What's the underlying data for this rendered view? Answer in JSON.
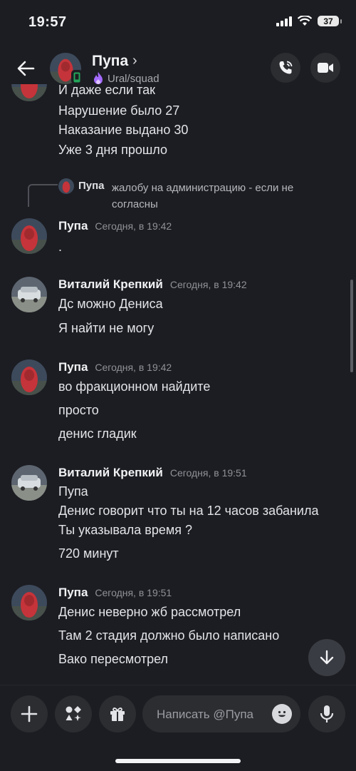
{
  "status_bar": {
    "time": "19:57",
    "battery": "37"
  },
  "header": {
    "name": "Пупа",
    "chevron": "›",
    "status": "Ural/squad",
    "icons": {
      "back": "arrow-left-icon",
      "call": "phone-call-icon",
      "video": "video-camera-icon"
    }
  },
  "messages": {
    "top_lines": [
      "И даже если так",
      "Нарушение было 27",
      "Наказание выдано 30",
      "Уже 3 дня прошло"
    ],
    "reply": {
      "author": "Пупа",
      "text": "жалобу на администрацию - если не согласны"
    },
    "groups": [
      {
        "author": "Пупа",
        "time": "Сегодня, в 19:42",
        "lines": [
          "."
        ]
      },
      {
        "author": "Виталий Крепкий",
        "time": "Сегодня, в 19:42",
        "lines": [
          "Дс можно Дениса",
          "Я найти не могу"
        ]
      },
      {
        "author": "Пупа",
        "time": "Сегодня, в 19:42",
        "lines": [
          "во фракционном найдите",
          "просто",
          "денис гладик"
        ]
      },
      {
        "author": "Виталий Крепкий",
        "time": "Сегодня, в 19:51",
        "lines": [
          "Пупа",
          "Денис говорит что ты на 12 часов забанила",
          "Ты указывала время ?",
          "720 минут"
        ]
      },
      {
        "author": "Пупа",
        "time": "Сегодня, в 19:51",
        "lines": [
          "Денис неверно жб рассмотрел",
          "Там 2 стадия должно было написано",
          "Вако пересмотрел"
        ]
      }
    ]
  },
  "composer": {
    "placeholder": "Написать @Пупа"
  },
  "colors": {
    "background": "#1c1d22",
    "surface": "#2b2d31",
    "text": "#f2f3f5",
    "muted": "#8f9198",
    "online_mobile": "#23a55a",
    "nitro_purple": "#a46bff"
  }
}
